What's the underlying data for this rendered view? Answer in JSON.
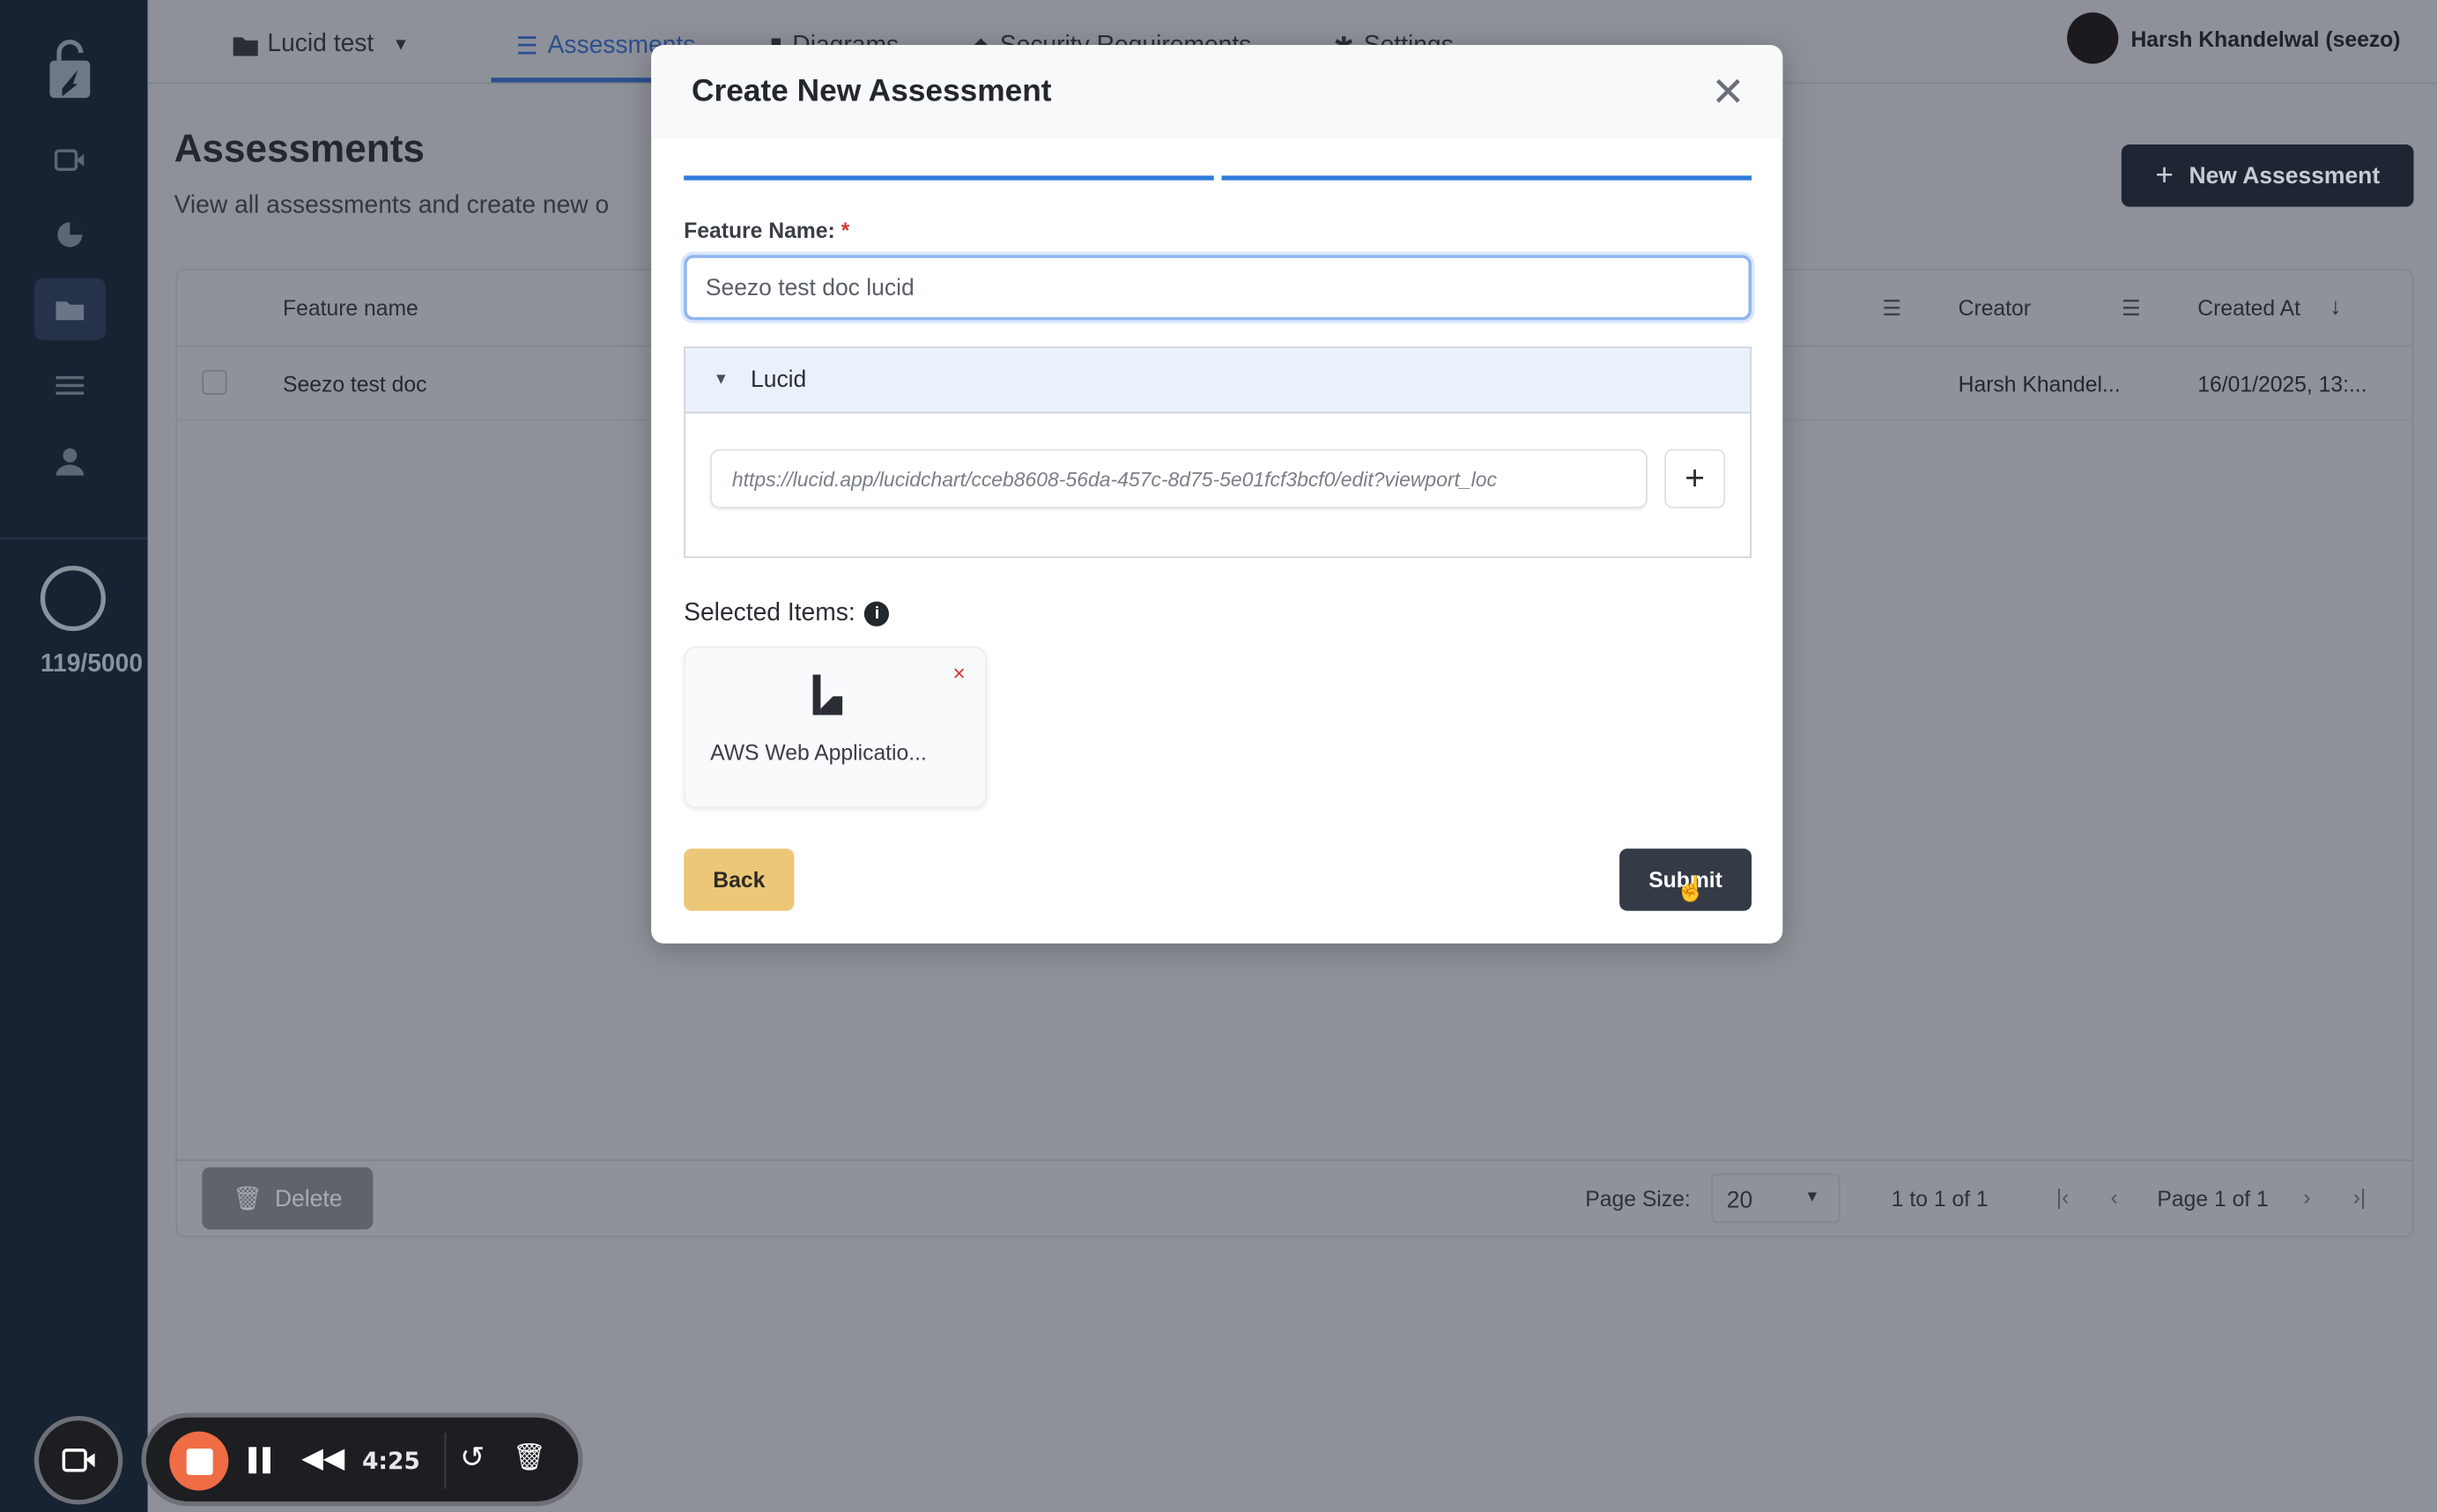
{
  "sidebar": {
    "counter": "119/5000",
    "items": [
      "logo",
      "video",
      "chart",
      "folder",
      "sliders",
      "user"
    ],
    "active": "folder"
  },
  "topbar": {
    "project": "Lucid test",
    "tabs": [
      {
        "label": "Assessments",
        "icon": "list-icon",
        "active": true
      },
      {
        "label": "Diagrams",
        "icon": "diagram-icon"
      },
      {
        "label": "Security Requirements",
        "icon": "shield-icon"
      },
      {
        "label": "Settings",
        "icon": "gear-icon"
      }
    ],
    "user": "Harsh Khandelwal (seezo)"
  },
  "page": {
    "title": "Assessments",
    "subtitle": "View all assessments and create new o",
    "new_button": "New Assessment"
  },
  "table": {
    "columns": [
      "Feature name",
      "Creator",
      "Created At"
    ],
    "rows": [
      {
        "feature": "Seezo test doc",
        "creator": "Harsh Khandel...",
        "created": "16/01/2025, 13:..."
      }
    ],
    "footer": {
      "delete": "Delete",
      "page_size_label": "Page Size:",
      "page_size": "20",
      "range": "1 to 1 of 1",
      "page": "Page 1 of 1"
    }
  },
  "modal": {
    "title": "Create New Assessment",
    "progress_steps": 2,
    "progress_completed": 2,
    "feature_label": "Feature Name:",
    "required": "*",
    "feature_value": "Seezo test doc lucid",
    "accordion_title": "Lucid",
    "url_placeholder": "https://lucid.app/lucidchart/cceb8608-56da-457c-8d75-5e01fcf3bcf0/edit?viewport_loc",
    "selected_label": "Selected Items:",
    "selected_items": [
      {
        "name": "AWS Web Applicatio..."
      }
    ],
    "back": "Back",
    "submit": "Submit"
  },
  "recorder": {
    "time": "4:25"
  },
  "colors": {
    "accent": "#2f7bd9",
    "back_button": "#ecc777",
    "submit_button": "#343a46",
    "stop": "#ef6c45"
  }
}
